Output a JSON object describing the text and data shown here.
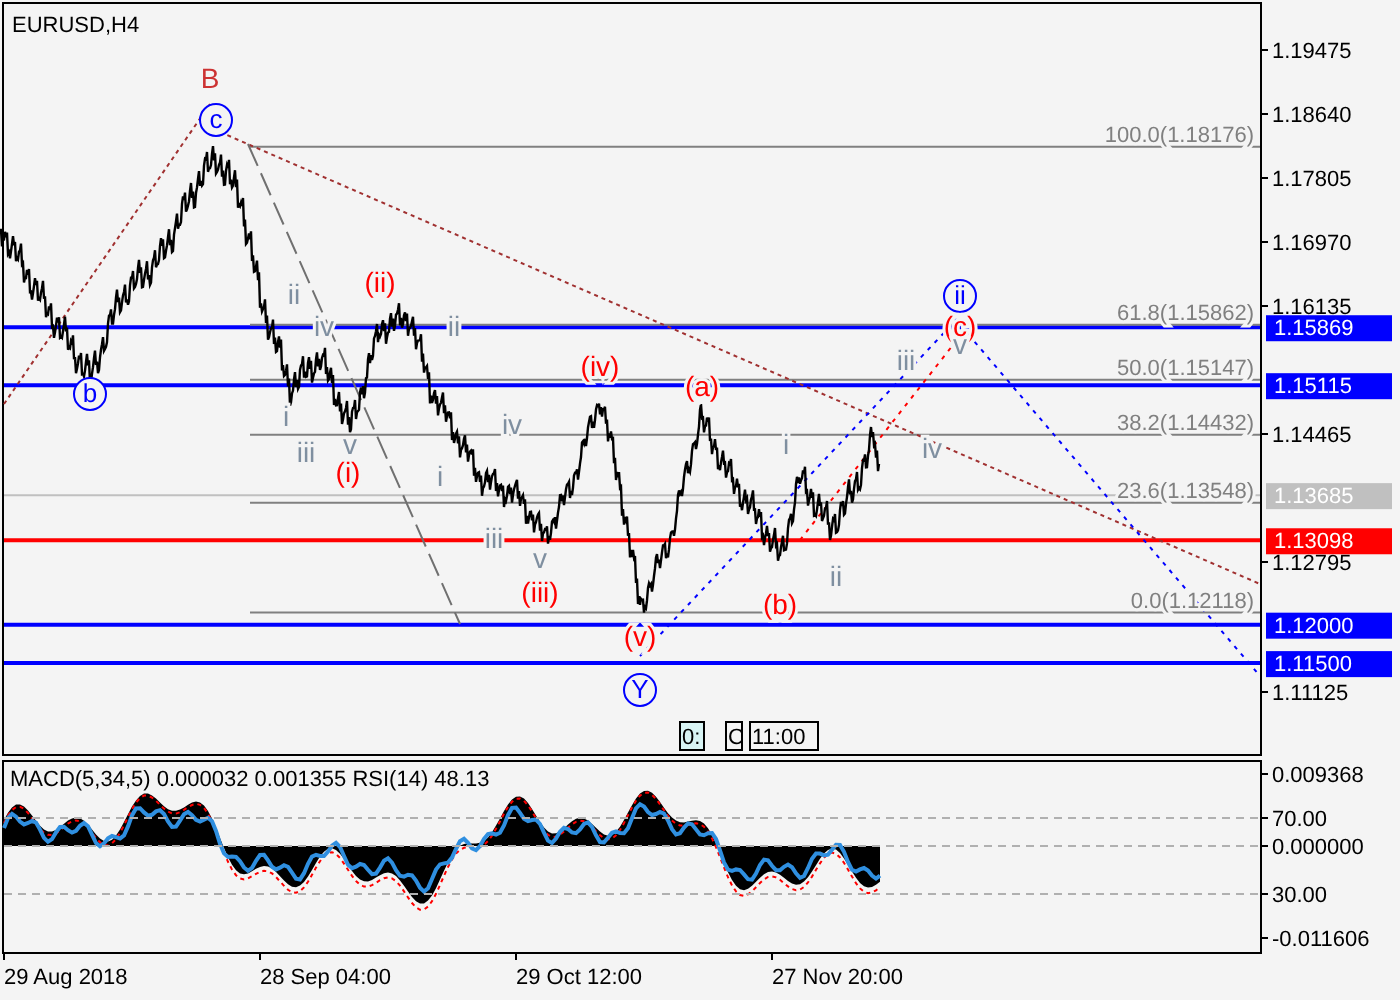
{
  "chart_title": "EURUSD,H4",
  "price_axis": [
    "1.19475",
    "1.18640",
    "1.17805",
    "1.16970",
    "1.16135",
    "1.14465",
    "1.12795",
    "1.11125"
  ],
  "price_tags": [
    {
      "label": "1.15869",
      "color": "#0000ff"
    },
    {
      "label": "1.15115",
      "color": "#0000ff"
    },
    {
      "label": "1.13685",
      "color": "#c0c0c0"
    },
    {
      "label": "1.13098",
      "color": "#ff0000"
    },
    {
      "label": "1.12000",
      "color": "#0000ff"
    },
    {
      "label": "1.11500",
      "color": "#0000ff"
    }
  ],
  "fib_levels": [
    "100.0(1.18176)",
    "61.8(1.15862)",
    "50.0(1.15147)",
    "38.2(1.14432)",
    "23.6(1.13548)",
    "0.0(1.12118)"
  ],
  "wave_labels": [
    {
      "text": "B",
      "kind": "plain",
      "color": "#cc3333"
    },
    {
      "text": "c",
      "kind": "circled",
      "color": "#0000ff"
    },
    {
      "text": "b",
      "kind": "circled",
      "color": "#0000ff"
    },
    {
      "text": "ii",
      "kind": "plain",
      "color": "#7f8fa0"
    },
    {
      "text": "iv",
      "kind": "plain",
      "color": "#7f8fa0"
    },
    {
      "text": "(ii)",
      "kind": "plain",
      "color": "#ff0000"
    },
    {
      "text": "ii",
      "kind": "plain",
      "color": "#7f8fa0"
    },
    {
      "text": "i",
      "kind": "plain",
      "color": "#7f8fa0"
    },
    {
      "text": "iii",
      "kind": "plain",
      "color": "#7f8fa0"
    },
    {
      "text": "v",
      "kind": "plain",
      "color": "#7f8fa0"
    },
    {
      "text": "(i)",
      "kind": "plain",
      "color": "#ff0000"
    },
    {
      "text": "i",
      "kind": "plain",
      "color": "#7f8fa0"
    },
    {
      "text": "iv",
      "kind": "plain",
      "color": "#7f8fa0"
    },
    {
      "text": "(iv)",
      "kind": "plain",
      "color": "#ff0000"
    },
    {
      "text": "(a)",
      "kind": "plain",
      "color": "#ff0000"
    },
    {
      "text": "iii",
      "kind": "plain",
      "color": "#7f8fa0"
    },
    {
      "text": "v",
      "kind": "plain",
      "color": "#7f8fa0"
    },
    {
      "text": "(iii)",
      "kind": "plain",
      "color": "#ff0000"
    },
    {
      "text": "(v)",
      "kind": "plain",
      "color": "#ff0000"
    },
    {
      "text": "Y",
      "kind": "circled",
      "color": "#0000ff"
    },
    {
      "text": "i",
      "kind": "plain",
      "color": "#7f8fa0"
    },
    {
      "text": "(b)",
      "kind": "plain",
      "color": "#ff0000"
    },
    {
      "text": "ii",
      "kind": "plain",
      "color": "#7f8fa0"
    },
    {
      "text": "iii",
      "kind": "plain",
      "color": "#7f8fa0"
    },
    {
      "text": "iv",
      "kind": "plain",
      "color": "#7f8fa0"
    },
    {
      "text": "ii",
      "kind": "circled",
      "color": "#0000ff"
    },
    {
      "text": "(c)",
      "kind": "plain",
      "color": "#ff0000"
    },
    {
      "text": "v",
      "kind": "plain",
      "color": "#7f8fa0"
    }
  ],
  "time_markers": [
    "0:",
    "C",
    "11:00"
  ],
  "indicator": {
    "title": "MACD(5,34,5) 0.000032 0.001355 RSI(14) 48.13",
    "axis": [
      "0.009368",
      "70.00",
      "0.000000",
      "30.00",
      "-0.011606"
    ]
  },
  "time_axis": [
    "29 Aug 2018",
    "28 Sep 04:00",
    "29 Oct 12:00",
    "27 Nov 20:00"
  ]
}
